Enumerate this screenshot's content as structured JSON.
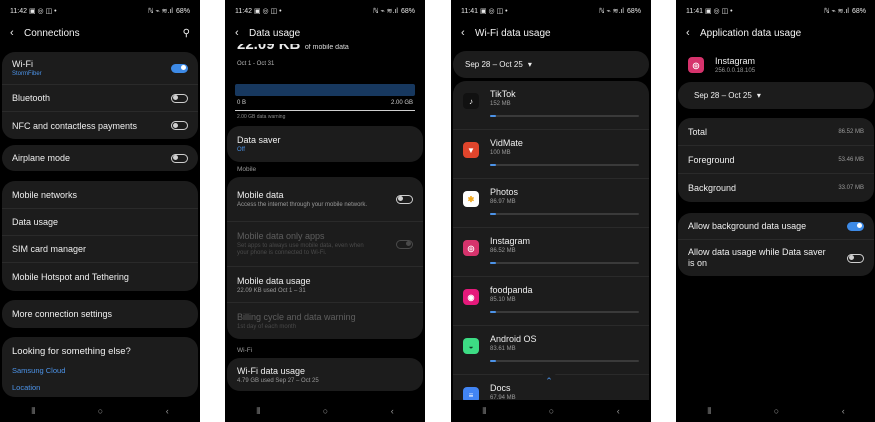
{
  "screens": {
    "connections": {
      "status": {
        "time": "11:42",
        "icons": "▣ ◎ ◫ •",
        "signal": "ℕ ⌁ ≋.ıl",
        "battery": "68%"
      },
      "title": "Connections",
      "wifi": {
        "label": "Wi-Fi",
        "network": "StormFiber"
      },
      "bluetooth": "Bluetooth",
      "nfc": "NFC and contactless payments",
      "airplane": "Airplane mode",
      "mobile_networks": "Mobile networks",
      "data_usage": "Data usage",
      "sim_manager": "SIM card manager",
      "hotspot": "Mobile Hotspot and Tethering",
      "more": "More connection settings",
      "looking": "Looking for something else?",
      "samsung_cloud": "Samsung Cloud",
      "location": "Location"
    },
    "data_usage": {
      "status": {
        "time": "11:42",
        "icons": "▣ ◎ ◫ •",
        "signal": "ℕ ⌁ ≋.ıl",
        "battery": "68%"
      },
      "title": "Data usage",
      "amount": "22.09 KB",
      "amount_suffix": "of mobile data",
      "period": "Oct 1 - Oct 31",
      "axis_min": "0 B",
      "axis_max": "2.00 GB",
      "warning": "2.00 GB data warning",
      "data_saver": {
        "label": "Data saver",
        "value": "Off"
      },
      "mobile_section": "Mobile",
      "mobile_data": {
        "label": "Mobile data",
        "desc": "Access the internet through your mobile network."
      },
      "mobile_only": {
        "label": "Mobile data only apps",
        "desc": "Set apps to always use mobile data, even when your phone is connected to Wi-Fi."
      },
      "mobile_usage": {
        "label": "Mobile data usage",
        "desc": "22.09 KB used Oct 1 – 31"
      },
      "billing": {
        "label": "Billing cycle and data warning",
        "desc": "1st day of each month"
      },
      "wifi_section": "Wi-Fi",
      "wifi_usage": {
        "label": "Wi-Fi data usage",
        "desc": "4.79 GB used Sep 27 – Oct 25"
      }
    },
    "wifi_usage": {
      "status": {
        "time": "11:41",
        "icons": "▣ ◎ ◫ •",
        "signal": "ℕ ⌁ ≋.ıl",
        "battery": "68%"
      },
      "title": "Wi-Fi data usage",
      "range": "Sep 28 – Oct 25",
      "apps": [
        {
          "name": "TikTok",
          "size": "152 MB",
          "icon": "♪",
          "color": "#111111",
          "fg": "#ffffff"
        },
        {
          "name": "VidMate",
          "size": "100 MB",
          "icon": "▼",
          "color": "#e0452c",
          "fg": "#ffffff"
        },
        {
          "name": "Photos",
          "size": "86.97 MB",
          "icon": "✱",
          "color": "#ffffff",
          "fg": "#f2a81d"
        },
        {
          "name": "Instagram",
          "size": "86.52 MB",
          "icon": "◎",
          "color": "#d6336c",
          "fg": "#ffffff"
        },
        {
          "name": "foodpanda",
          "size": "85.10 MB",
          "icon": "◉",
          "color": "#e6197b",
          "fg": "#ffffff"
        },
        {
          "name": "Android OS",
          "size": "83.61 MB",
          "icon": "◒",
          "color": "#3ddc84",
          "fg": "#0d3b24"
        },
        {
          "name": "Docs",
          "size": "67.94 MB",
          "icon": "≡",
          "color": "#4285f4",
          "fg": "#ffffff"
        }
      ]
    },
    "app_usage": {
      "status": {
        "time": "11:41",
        "icons": "▣ ◎ ◫ •",
        "signal": "ℕ ⌁ ≋.ıl",
        "battery": "68%"
      },
      "title": "Application data usage",
      "app_name": "Instagram",
      "app_version": "256.0.0.18.105",
      "range": "Sep 28 – Oct 25",
      "total": {
        "label": "Total",
        "value": "86.52 MB"
      },
      "foreground": {
        "label": "Foreground",
        "value": "53.46 MB"
      },
      "background": {
        "label": "Background",
        "value": "33.07 MB"
      },
      "allow_bg": "Allow background data usage",
      "allow_saver": "Allow data usage while Data saver is on"
    }
  },
  "nav": {
    "recents": "⦀",
    "home": "○",
    "back": "‹"
  },
  "colors": {
    "accent": "#3d8ae6",
    "card": "#1c1c1c",
    "background": "#000000"
  }
}
